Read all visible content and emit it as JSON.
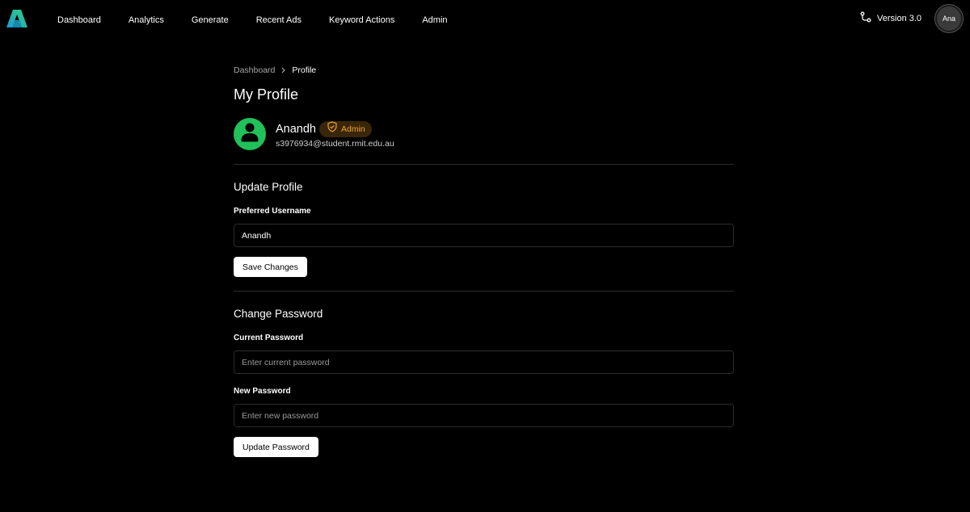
{
  "nav": {
    "items": [
      {
        "label": "Dashboard"
      },
      {
        "label": "Analytics"
      },
      {
        "label": "Generate"
      },
      {
        "label": "Recent Ads"
      },
      {
        "label": "Keyword Actions"
      },
      {
        "label": "Admin"
      }
    ],
    "version_label": "Version 3.0",
    "version_icon": "git-branch-icon",
    "user_initials": "Ana"
  },
  "breadcrumb": {
    "parent": "Dashboard",
    "current": "Profile"
  },
  "page": {
    "title": "My Profile"
  },
  "profile": {
    "name": "Anandh",
    "role_badge": "Admin",
    "email": "s3976934@student.rmit.edu.au",
    "avatar_color": "#21c15a"
  },
  "update_profile": {
    "title": "Update Profile",
    "username_label": "Preferred Username",
    "username_value": "Anandh",
    "save_label": "Save Changes"
  },
  "change_password": {
    "title": "Change Password",
    "current_label": "Current Password",
    "current_placeholder": "Enter current password",
    "new_label": "New Password",
    "new_placeholder": "Enter new password",
    "submit_label": "Update Password"
  },
  "colors": {
    "background": "#000000",
    "accent_green": "#21c15a",
    "badge_text": "#f0a32e",
    "badge_bg": "#3a2608"
  }
}
